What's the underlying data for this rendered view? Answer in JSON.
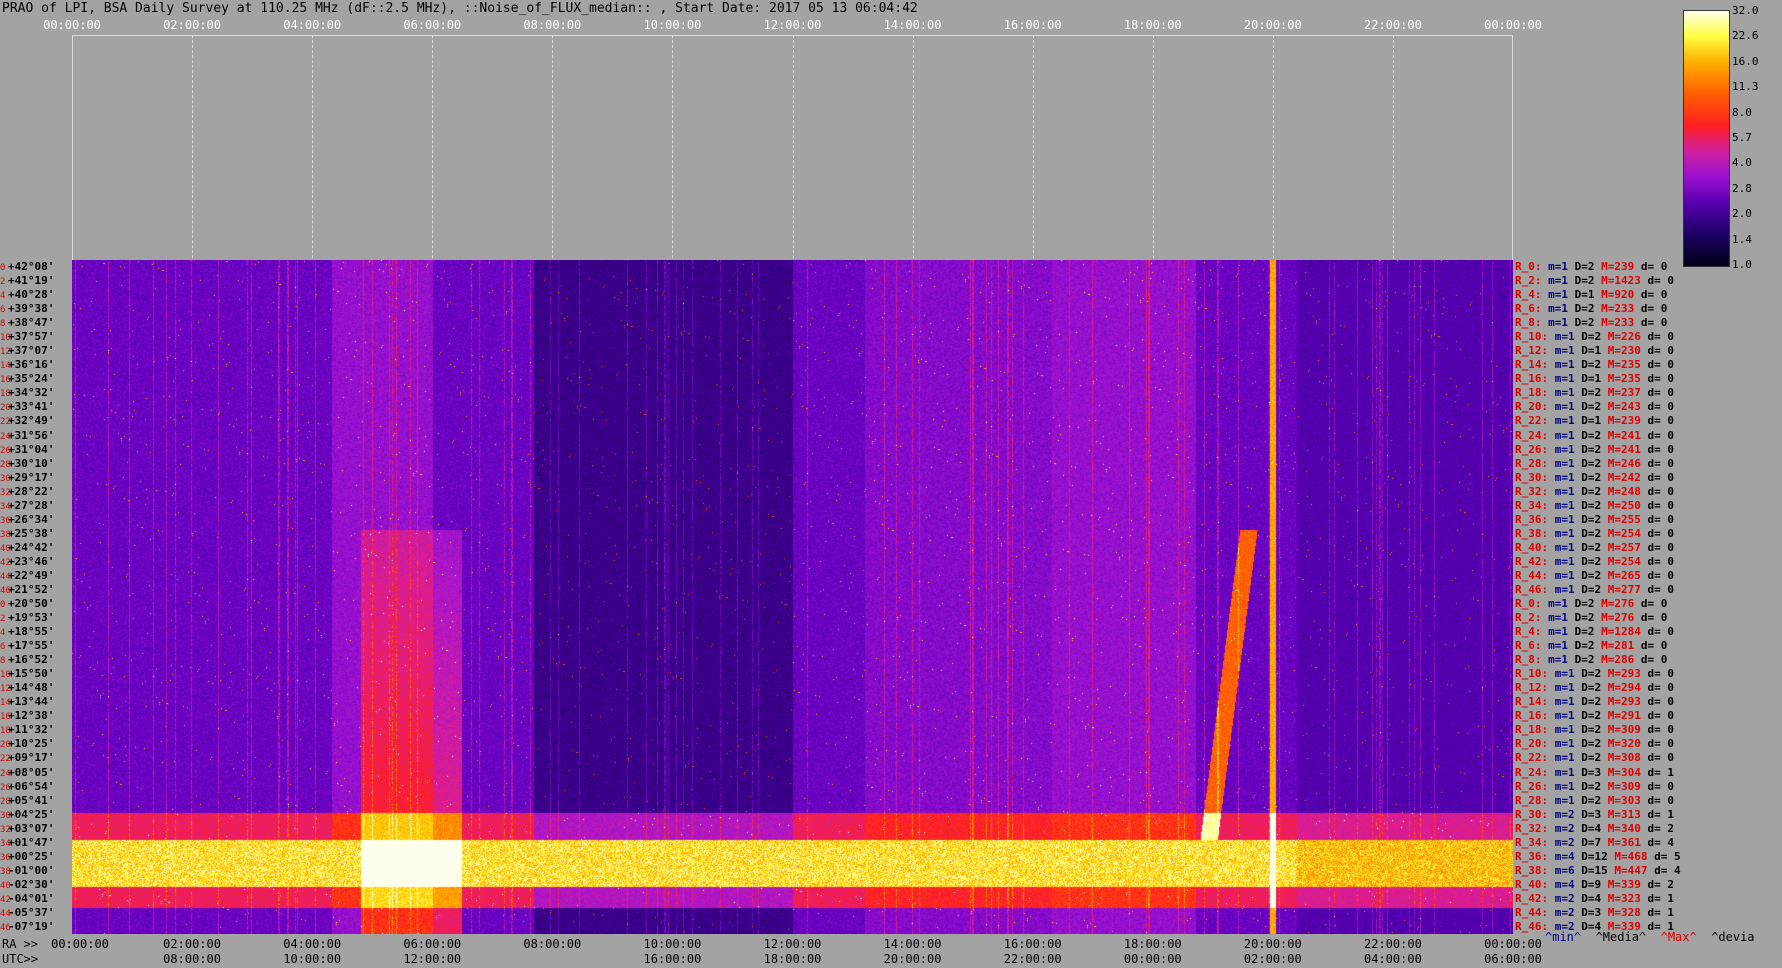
{
  "title": "PRAO of LPI, BSA Daily Survey at 110.25 MHz (dF::2.5 MHz), ::Noise_of_FLUX_median:: , Start Date: 2017 05 13 06:04:42",
  "top_ticks": [
    "00:00:00",
    "02:00:00",
    "04:00:00",
    "06:00:00",
    "08:00:00",
    "10:00:00",
    "12:00:00",
    "14:00:00",
    "16:00:00",
    "18:00:00",
    "20:00:00",
    "22:00:00",
    "00:00:00"
  ],
  "ra_prefix": "RA >>",
  "ra_ticks": [
    "00:00:00",
    "02:00:00",
    "04:00:00",
    "06:00:00",
    "08:00:00",
    "10:00:00",
    "12:00:00",
    "14:00:00",
    "16:00:00",
    "18:00:00",
    "20:00:00",
    "22:00:00",
    "00:00:00"
  ],
  "utc_prefix": "UTC>>",
  "utc_ticks": [
    "08:00:00",
    "10:00:00",
    "12:00:00",
    "16:00:00",
    "18:00:00",
    "20:00:00",
    "22:00:00",
    "00:00:00",
    "02:00:00",
    "04:00:00",
    "06:00:00"
  ],
  "colorbar_labels": [
    "32.0",
    "22.6",
    "16.0",
    "11.3",
    "8.0",
    "5.7",
    "4.0",
    "2.8",
    "2.0",
    "1.4",
    "1.0"
  ],
  "legend": {
    "min": "^min^",
    "media": "^Media^",
    "max": "^Max^",
    "devia": "^devia"
  },
  "declinations": [
    {
      "i": "0",
      "d": "+42°08'"
    },
    {
      "i": "2",
      "d": "+41°19'"
    },
    {
      "i": "4",
      "d": "+40°28'"
    },
    {
      "i": "6",
      "d": "+39°38'"
    },
    {
      "i": "8",
      "d": "+38°47'"
    },
    {
      "i": "10",
      "d": "+37°57'"
    },
    {
      "i": "12",
      "d": "+37°07'"
    },
    {
      "i": "14",
      "d": "+36°16'"
    },
    {
      "i": "16",
      "d": "+35°24'"
    },
    {
      "i": "18",
      "d": "+34°32'"
    },
    {
      "i": "20",
      "d": "+33°41'"
    },
    {
      "i": "22",
      "d": "+32°49'"
    },
    {
      "i": "24",
      "d": "+31°56'"
    },
    {
      "i": "26",
      "d": "+31°04'"
    },
    {
      "i": "28",
      "d": "+30°10'"
    },
    {
      "i": "30",
      "d": "+29°17'"
    },
    {
      "i": "32",
      "d": "+28°22'"
    },
    {
      "i": "34",
      "d": "+27°28'"
    },
    {
      "i": "36",
      "d": "+26°34'"
    },
    {
      "i": "38",
      "d": "+25°38'"
    },
    {
      "i": "40",
      "d": "+24°42'"
    },
    {
      "i": "42",
      "d": "+23°46'"
    },
    {
      "i": "44",
      "d": "+22°49'"
    },
    {
      "i": "46",
      "d": "+21°52'"
    },
    {
      "i": "0",
      "d": "+20°50'"
    },
    {
      "i": "2",
      "d": "+19°53'"
    },
    {
      "i": "4",
      "d": "+18°55'"
    },
    {
      "i": "6",
      "d": "+17°55'"
    },
    {
      "i": "8",
      "d": "+16°52'"
    },
    {
      "i": "10",
      "d": "+15°50'"
    },
    {
      "i": "12",
      "d": "+14°48'"
    },
    {
      "i": "14",
      "d": "+13°44'"
    },
    {
      "i": "16",
      "d": "+12°38'"
    },
    {
      "i": "18",
      "d": "+11°32'"
    },
    {
      "i": "20",
      "d": "+10°25'"
    },
    {
      "i": "22",
      "d": "+09°17'"
    },
    {
      "i": "24",
      "d": "+08°05'"
    },
    {
      "i": "26",
      "d": "+06°54'"
    },
    {
      "i": "28",
      "d": "+05°41'"
    },
    {
      "i": "30",
      "d": "+04°25'"
    },
    {
      "i": "32",
      "d": "+03°07'"
    },
    {
      "i": "34",
      "d": "+01°47'"
    },
    {
      "i": "36",
      "d": "+00°25'"
    },
    {
      "i": "38",
      "d": "-01°00'"
    },
    {
      "i": "40",
      "d": "-02°30'"
    },
    {
      "i": "42",
      "d": "-04°01'"
    },
    {
      "i": "44",
      "d": "-05°37'"
    },
    {
      "i": "46",
      "d": "-07°19'"
    }
  ],
  "stats": [
    {
      "r": "R_0:",
      "n": "m=1",
      "d": "D=2",
      "m": "M=239",
      "k": "d= 0"
    },
    {
      "r": "R_2:",
      "n": "m=1",
      "d": "D=2",
      "m": "M=1423",
      "k": "d= 0"
    },
    {
      "r": "R_4:",
      "n": "m=1",
      "d": "D=1",
      "m": "M=920",
      "k": "d= 0"
    },
    {
      "r": "R_6:",
      "n": "m=1",
      "d": "D=2",
      "m": "M=233",
      "k": "d= 0"
    },
    {
      "r": "R_8:",
      "n": "m=1",
      "d": "D=2",
      "m": "M=233",
      "k": "d= 0"
    },
    {
      "r": "R_10:",
      "n": "m=1",
      "d": "D=2",
      "m": "M=226",
      "k": "d= 0"
    },
    {
      "r": "R_12:",
      "n": "m=1",
      "d": "D=1",
      "m": "M=230",
      "k": "d= 0"
    },
    {
      "r": "R_14:",
      "n": "m=1",
      "d": "D=2",
      "m": "M=235",
      "k": "d= 0"
    },
    {
      "r": "R_16:",
      "n": "m=1",
      "d": "D=1",
      "m": "M=235",
      "k": "d= 0"
    },
    {
      "r": "R_18:",
      "n": "m=1",
      "d": "D=2",
      "m": "M=237",
      "k": "d= 0"
    },
    {
      "r": "R_20:",
      "n": "m=1",
      "d": "D=2",
      "m": "M=243",
      "k": "d= 0"
    },
    {
      "r": "R_22:",
      "n": "m=1",
      "d": "D=1",
      "m": "M=239",
      "k": "d= 0"
    },
    {
      "r": "R_24:",
      "n": "m=1",
      "d": "D=2",
      "m": "M=241",
      "k": "d= 0"
    },
    {
      "r": "R_26:",
      "n": "m=1",
      "d": "D=2",
      "m": "M=241",
      "k": "d= 0"
    },
    {
      "r": "R_28:",
      "n": "m=1",
      "d": "D=2",
      "m": "M=246",
      "k": "d= 0"
    },
    {
      "r": "R_30:",
      "n": "m=1",
      "d": "D=2",
      "m": "M=242",
      "k": "d= 0"
    },
    {
      "r": "R_32:",
      "n": "m=1",
      "d": "D=2",
      "m": "M=248",
      "k": "d= 0"
    },
    {
      "r": "R_34:",
      "n": "m=1",
      "d": "D=2",
      "m": "M=250",
      "k": "d= 0"
    },
    {
      "r": "R_36:",
      "n": "m=1",
      "d": "D=2",
      "m": "M=255",
      "k": "d= 0"
    },
    {
      "r": "R_38:",
      "n": "m=1",
      "d": "D=2",
      "m": "M=254",
      "k": "d= 0"
    },
    {
      "r": "R_40:",
      "n": "m=1",
      "d": "D=2",
      "m": "M=257",
      "k": "d= 0"
    },
    {
      "r": "R_42:",
      "n": "m=1",
      "d": "D=2",
      "m": "M=254",
      "k": "d= 0"
    },
    {
      "r": "R_44:",
      "n": "m=1",
      "d": "D=2",
      "m": "M=265",
      "k": "d= 0"
    },
    {
      "r": "R_46:",
      "n": "m=1",
      "d": "D=2",
      "m": "M=277",
      "k": "d= 0"
    },
    {
      "r": "R_0:",
      "n": "m=1",
      "d": "D=2",
      "m": "M=276",
      "k": "d= 0"
    },
    {
      "r": "R_2:",
      "n": "m=1",
      "d": "D=2",
      "m": "M=276",
      "k": "d= 0"
    },
    {
      "r": "R_4:",
      "n": "m=1",
      "d": "D=2",
      "m": "M=1284",
      "k": "d= 0"
    },
    {
      "r": "R_6:",
      "n": "m=1",
      "d": "D=2",
      "m": "M=281",
      "k": "d= 0"
    },
    {
      "r": "R_8:",
      "n": "m=1",
      "d": "D=2",
      "m": "M=286",
      "k": "d= 0"
    },
    {
      "r": "R_10:",
      "n": "m=1",
      "d": "D=2",
      "m": "M=293",
      "k": "d= 0"
    },
    {
      "r": "R_12:",
      "n": "m=1",
      "d": "D=2",
      "m": "M=294",
      "k": "d= 0"
    },
    {
      "r": "R_14:",
      "n": "m=1",
      "d": "D=2",
      "m": "M=293",
      "k": "d= 0"
    },
    {
      "r": "R_16:",
      "n": "m=1",
      "d": "D=2",
      "m": "M=291",
      "k": "d= 0"
    },
    {
      "r": "R_18:",
      "n": "m=1",
      "d": "D=2",
      "m": "M=309",
      "k": "d= 0"
    },
    {
      "r": "R_20:",
      "n": "m=1",
      "d": "D=2",
      "m": "M=320",
      "k": "d= 0"
    },
    {
      "r": "R_22:",
      "n": "m=1",
      "d": "D=2",
      "m": "M=308",
      "k": "d= 0"
    },
    {
      "r": "R_24:",
      "n": "m=1",
      "d": "D=3",
      "m": "M=304",
      "k": "d= 1"
    },
    {
      "r": "R_26:",
      "n": "m=1",
      "d": "D=2",
      "m": "M=309",
      "k": "d= 0"
    },
    {
      "r": "R_28:",
      "n": "m=1",
      "d": "D=2",
      "m": "M=303",
      "k": "d= 0"
    },
    {
      "r": "R_30:",
      "n": "m=2",
      "d": "D=3",
      "m": "M=313",
      "k": "d= 1"
    },
    {
      "r": "R_32:",
      "n": "m=2",
      "d": "D=4",
      "m": "M=340",
      "k": "d= 2"
    },
    {
      "r": "R_34:",
      "n": "m=2",
      "d": "D=7",
      "m": "M=361",
      "k": "d= 4"
    },
    {
      "r": "R_36:",
      "n": "m=4",
      "d": "D=12",
      "m": "M=468",
      "k": "d= 5"
    },
    {
      "r": "R_38:",
      "n": "m=6",
      "d": "D=15",
      "m": "M=447",
      "k": "d= 4"
    },
    {
      "r": "R_40:",
      "n": "m=4",
      "d": "D=9",
      "m": "M=339",
      "k": "d= 2"
    },
    {
      "r": "R_42:",
      "n": "m=2",
      "d": "D=4",
      "m": "M=323",
      "k": "d= 1"
    },
    {
      "r": "R_44:",
      "n": "m=2",
      "d": "D=3",
      "m": "M=328",
      "k": "d= 1"
    },
    {
      "r": "R_46:",
      "n": "m=2",
      "d": "D=4",
      "m": "M=339",
      "k": "d= 1"
    }
  ],
  "colors": {
    "background": "#a3a3a3",
    "plot_dark": "#140038",
    "max_label": "#e00000",
    "index_label": "#000080"
  }
}
